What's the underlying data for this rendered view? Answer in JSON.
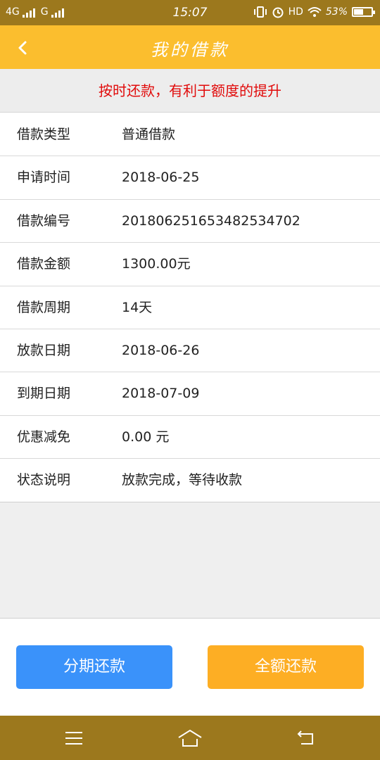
{
  "status_bar": {
    "network_1": "4G",
    "network_2": "G",
    "time": "15:07",
    "hd": "HD",
    "battery": "53%",
    "battery_level": 0.53
  },
  "header": {
    "title": "我的借款",
    "back_icon": "chevron-left-icon"
  },
  "notice": "按时还款，有利于额度的提升",
  "details": [
    {
      "label": "借款类型",
      "value": "普通借款"
    },
    {
      "label": "申请时间",
      "value": "2018-06-25"
    },
    {
      "label": "借款编号",
      "value": "20180625165348253470​2"
    },
    {
      "label": "借款金额",
      "value": "1300.00元"
    },
    {
      "label": "借款周期",
      "value": "14天"
    },
    {
      "label": "放款日期",
      "value": "2018-06-26"
    },
    {
      "label": "到期日期",
      "value": "2018-07-09"
    },
    {
      "label": "优惠减免",
      "value": "0.00 元"
    },
    {
      "label": "状态说明",
      "value": "放款完成，等待收款"
    }
  ],
  "actions": {
    "installment": "分期还款",
    "full": "全额还款"
  },
  "colors": {
    "status_bar": "#9c781d",
    "header": "#fbbe2e",
    "notice_text": "#e10b0b",
    "installment_button": "#3a92fa",
    "full_button": "#fdae24"
  },
  "nav_icons": [
    "menu-icon",
    "home-icon",
    "back-icon"
  ]
}
